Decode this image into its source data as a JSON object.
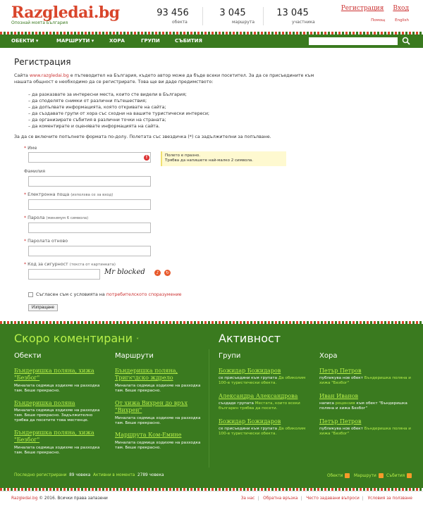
{
  "header": {
    "logo": "Razgledai.bg",
    "tagline": "Опознай моята България",
    "stats": [
      {
        "num": "93 456",
        "label": "обекта"
      },
      {
        "num": "3 045",
        "label": "маршрута"
      },
      {
        "num": "13 045",
        "label": "участника"
      }
    ],
    "register": "Регистрация",
    "login": "Вход",
    "help": "Помощ",
    "english": "English"
  },
  "nav": {
    "items": [
      "ОБЕКТИ",
      "МАРШРУТИ",
      "ХОРА",
      "ГРУПИ",
      "СЪБИТИЯ"
    ],
    "search_value": ""
  },
  "page": {
    "title": "Регистрация",
    "intro_pre": "Сайта ",
    "intro_link": "www.razgledai.bg",
    "intro_post": " е пътеводител на България, където автор може да бъде всеки посетител. За да се присъедините към нашата общност е необходимо да се регистрирате. Това ще ви даде предимството:",
    "bullets": [
      "– да разказвате за интересни места, които сте видели в България;",
      "– да споделяте снимки от различни пътешествия;",
      "– да допълвате информацията, която откривате на сайта;",
      "– да създавате групи от хора със сходни на вашите туристически интереси;",
      "– да организирате събития в различни точки на страната;",
      "– да коментирате и оценявате информацията на сайта."
    ],
    "note": "За да се включите попълнете формата по-долу. Полетата със звездичка (*) са задължителни за попълване.",
    "fields": {
      "name": "Име",
      "surname": "Фамилия",
      "email": "Електронна поща",
      "email_hint": "(използва се за вход)",
      "password": "Парола",
      "password_hint": "(минимум 6 символа)",
      "password2": "Паролата отново",
      "captcha": "Код за сигурност",
      "captcha_hint": "(текста от картинката)"
    },
    "error_line1": "Полето е празно.",
    "error_line2": "Трябва да напишете най-малко 2 символа.",
    "captcha_text": "Mr blocked",
    "terms_pre": "Съгласен съм с условията на ",
    "terms_link": "потребителското споразумение",
    "submit": "Изпращане"
  },
  "footer": {
    "recent_title": "Скоро коментирани",
    "activity_title": "Активност",
    "columns": [
      {
        "title": "Обекти",
        "entries": [
          {
            "link": "Бъндеришка поляна, хижа \"Безбог\"",
            "text": "Миналата седмица ходихме на разходка там. Беше прекрасно."
          },
          {
            "link": "Бъндеришка поляна",
            "text": "Миналата седмица ходихме на разходка там. Беше прекрасно. Задължително трябва да посетите това местенце."
          },
          {
            "link": "Бъндеришка поляна, хижа \"Безбог\"",
            "text": "Миналата седмица ходихме на разходка там. Беше прекрасно."
          }
        ]
      },
      {
        "title": "Маршрути",
        "entries": [
          {
            "link": "Бъндеришка поляна, Тригראдско ждрело",
            "text": "Миналата седмица ходихме на разходка там. Беше прекрасно."
          },
          {
            "link": "От хижа Вихрен до връх \"Вихрен\"",
            "text": "Миналата седмица ходихме на разходка там. Беше прекрасно."
          },
          {
            "link": "Маршрута Ком-Емине",
            "text": "Миналата седмица ходихме на разходка там. Беше прекрасно."
          }
        ]
      },
      {
        "title": "Групи",
        "entries": [
          {
            "link": "Божидар Божидаров",
            "pre": "се присъедини към групата ",
            "a": "Да обиколим 100-в туристически обекта.",
            "post": ""
          },
          {
            "link": "Александра Александрова",
            "pre": "създаде групата ",
            "a": "Местата, които всеки българин трябва да посети.",
            "post": ""
          },
          {
            "link": "Божидар Божидаров",
            "pre": "се присъедини към групата ",
            "a": "Да обиколим 100-в туристически обекта.",
            "post": ""
          }
        ]
      },
      {
        "title": "Хора",
        "entries": [
          {
            "link": "Петър Петров",
            "pre": "публикува нов обект ",
            "a": "Бъндеришка поляна и хижа \"Безбог\"",
            "post": ""
          },
          {
            "link": "Иван Иванов",
            "pre": "написа ",
            "a": "рецензия",
            "post": " към обект \"Бъндеришка поляна и хижа Безбог\""
          },
          {
            "link": "Петър Петров",
            "pre": "публикува нов обект ",
            "a": "Бъндеришка поляна и хижа \"Безбог\"",
            "post": ""
          }
        ]
      }
    ],
    "recent_reg": "Последно регистрирани",
    "recent_reg_count": "89 човека",
    "active_now": "Активни в момента",
    "active_now_count": "2789 човека",
    "feeds": [
      "Обекти",
      "Маршрути",
      "Събития"
    ]
  },
  "copyright": {
    "site": "Razgledai.bg",
    "text": " © 2016. Всички права запазени",
    "links": [
      "За нас",
      "Обратна връзка",
      "Често задавани въпроси",
      "Условия за ползване"
    ]
  }
}
